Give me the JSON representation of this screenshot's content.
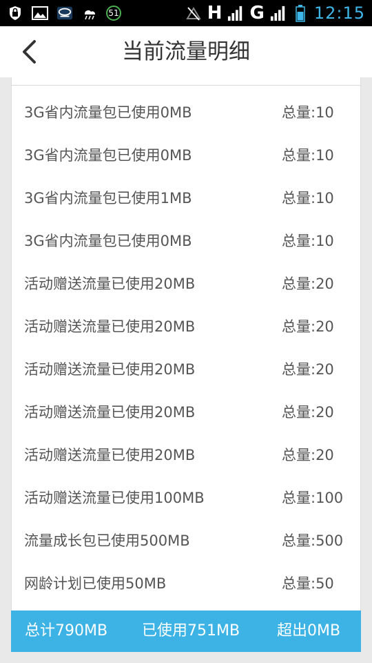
{
  "status_bar": {
    "icons": [
      "shield-icon",
      "image-icon",
      "app-icon",
      "weather-icon",
      "badge-icon"
    ],
    "badge_value": "51",
    "network_h": "H",
    "network_g": "G",
    "time": "12:15"
  },
  "header": {
    "title": "当前流量明细",
    "back_icon": "chevron-left-icon"
  },
  "items": [
    {
      "name": "3G省内流量包已使用0MB",
      "total": "总量:10"
    },
    {
      "name": "3G省内流量包已使用0MB",
      "total": "总量:10"
    },
    {
      "name": "3G省内流量包已使用1MB",
      "total": "总量:10"
    },
    {
      "name": "3G省内流量包已使用0MB",
      "total": "总量:10"
    },
    {
      "name": "活动赠送流量已使用20MB",
      "total": "总量:20"
    },
    {
      "name": "活动赠送流量已使用20MB",
      "total": "总量:20"
    },
    {
      "name": "活动赠送流量已使用20MB",
      "total": "总量:20"
    },
    {
      "name": "活动赠送流量已使用20MB",
      "total": "总量:20"
    },
    {
      "name": "活动赠送流量已使用20MB",
      "total": "总量:20"
    },
    {
      "name": "活动赠送流量已使用100MB",
      "total": "总量:100"
    },
    {
      "name": "流量成长包已使用500MB",
      "total": "总量:500"
    },
    {
      "name": "网龄计划已使用50MB",
      "total": "总量:50"
    }
  ],
  "footer": {
    "total": "总计790MB",
    "used": "已使用751MB",
    "exceeded": "超出0MB"
  },
  "colors": {
    "accent": "#3cb3e4",
    "time": "#3fb6e8",
    "badge_ring": "#4caf50"
  }
}
